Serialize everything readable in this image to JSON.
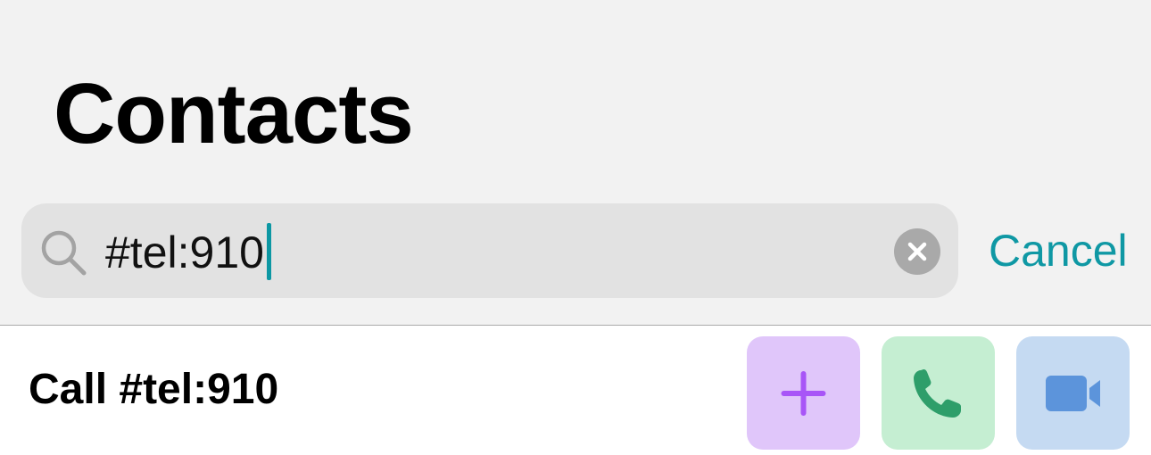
{
  "header": {
    "title": "Contacts"
  },
  "search": {
    "query": "#tel:910",
    "cancel_label": "Cancel"
  },
  "result": {
    "label": "Call #tel:910",
    "actions": [
      {
        "name": "add",
        "icon": "plus-icon",
        "color": "#a855f7",
        "bg": "#e0c6fa"
      },
      {
        "name": "call",
        "icon": "phone-icon",
        "color": "#2e9e6a",
        "bg": "#c5eed2"
      },
      {
        "name": "video",
        "icon": "video-camera-icon",
        "color": "#5c94db",
        "bg": "#c5daf2"
      }
    ]
  },
  "colors": {
    "accent": "#0f98a4",
    "caret": "#0c97a3"
  }
}
